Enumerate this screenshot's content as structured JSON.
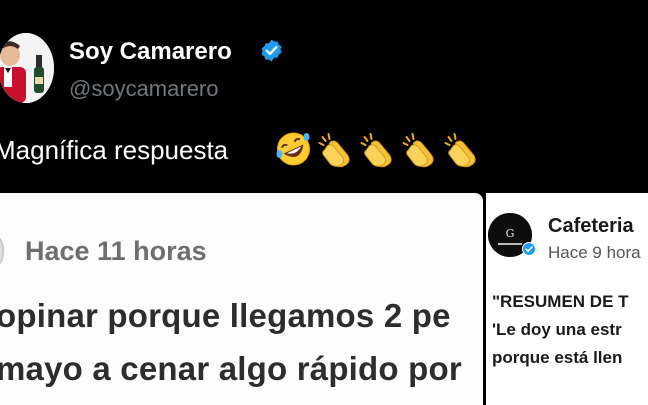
{
  "tweet": {
    "author_name": "Soy Camarero",
    "handle": "@soycamarero",
    "text": "Magnífica respuesta",
    "emojis": [
      "rofl-emoji",
      "clapping-hands-emoji",
      "clapping-hands-emoji",
      "clapping-hands-emoji",
      "clapping-hands-emoji"
    ],
    "verified_color": "#1d9bf0"
  },
  "left_card": {
    "time": "Hace 11 horas",
    "line1": "opinar porque llegamos 2 pe",
    "line2": "mayo a cenar algo rápido por"
  },
  "right_card": {
    "name": "Cafeteria",
    "time": "Hace 9 hora",
    "line1": "\"RESUMEN DE T",
    "line2": "'Le doy una estr",
    "line3": "porque está llen"
  }
}
